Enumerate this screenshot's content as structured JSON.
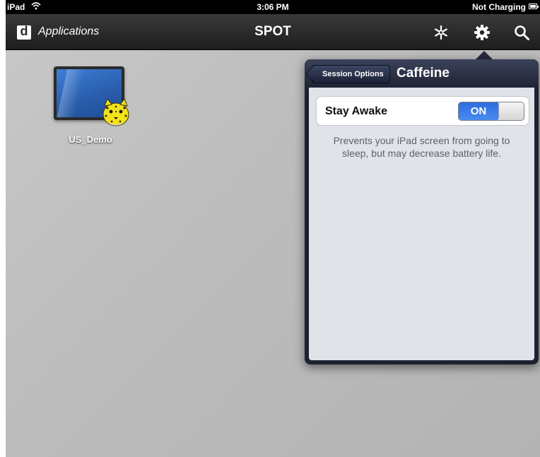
{
  "status_bar": {
    "carrier": "iPad",
    "time": "3:06 PM",
    "charging": "Not Charging"
  },
  "nav_bar": {
    "back_label": "Applications",
    "title": "SPOT",
    "icons": [
      "snowflake-icon",
      "gear-icon",
      "search-icon"
    ]
  },
  "desktop": {
    "apps": [
      {
        "label": "US_Demo"
      }
    ]
  },
  "popover": {
    "back_button": "Session Options",
    "title": "Caffeine",
    "setting": {
      "label": "Stay Awake",
      "toggle_state": "ON",
      "enabled": true,
      "description": "Prevents your iPad screen from going to sleep, but may decrease battery life."
    }
  },
  "colors": {
    "status_bar": "#000000",
    "nav_bar": "#2a2a2a",
    "desktop_bg": "#bdbdbd",
    "popover_header": "#2b3045",
    "toggle_on": "#2c6ce0"
  }
}
